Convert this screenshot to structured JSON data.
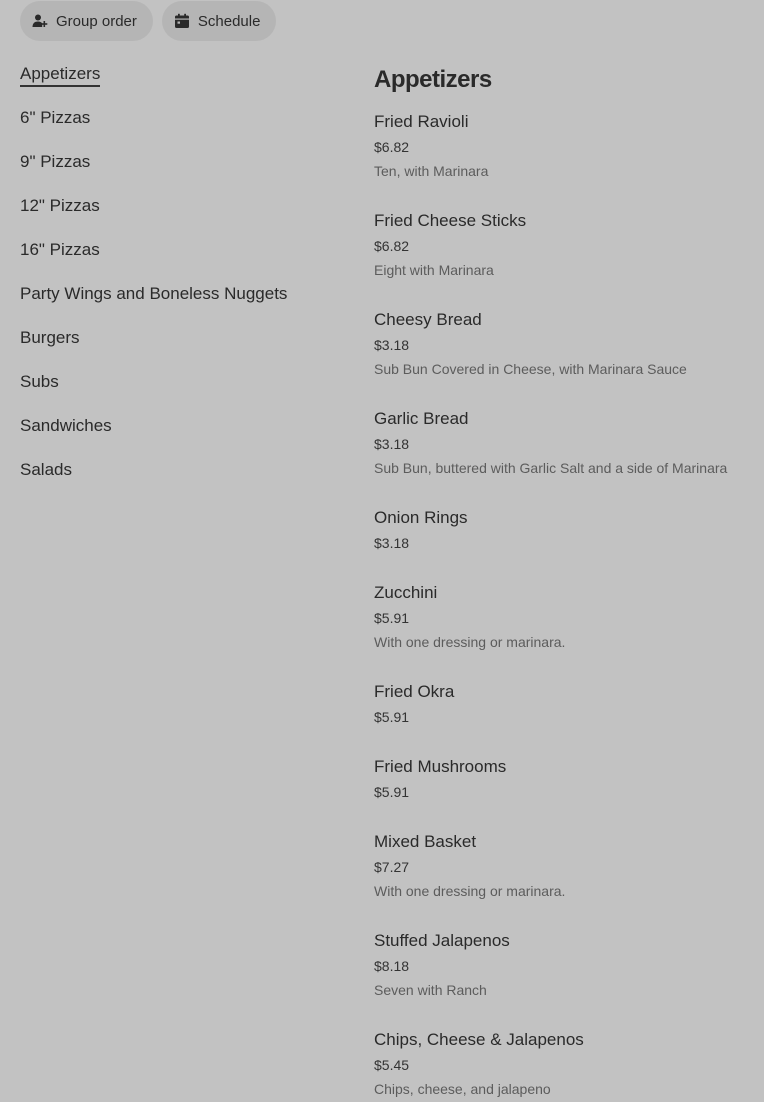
{
  "actions": {
    "group_order": "Group order",
    "schedule": "Schedule"
  },
  "categories": [
    {
      "label": "Appetizers",
      "active": true
    },
    {
      "label": "6\" Pizzas"
    },
    {
      "label": "9\" Pizzas"
    },
    {
      "label": "12\" Pizzas"
    },
    {
      "label": "16\" Pizzas"
    },
    {
      "label": "Party Wings and Boneless Nuggets"
    },
    {
      "label": "Burgers"
    },
    {
      "label": "Subs"
    },
    {
      "label": "Sandwiches"
    },
    {
      "label": "Salads"
    }
  ],
  "section": {
    "title": "Appetizers",
    "items": [
      {
        "name": "Fried Ravioli",
        "price": "$6.82",
        "desc": "Ten, with Marinara"
      },
      {
        "name": "Fried Cheese Sticks",
        "price": "$6.82",
        "desc": "Eight with Marinara"
      },
      {
        "name": "Cheesy Bread",
        "price": "$3.18",
        "desc": "Sub Bun Covered in Cheese, with Marinara Sauce"
      },
      {
        "name": "Garlic Bread",
        "price": "$3.18",
        "desc": "Sub Bun, buttered with Garlic Salt and a side of Marinara"
      },
      {
        "name": "Onion Rings",
        "price": "$3.18",
        "desc": ""
      },
      {
        "name": "Zucchini",
        "price": "$5.91",
        "desc": "With one dressing or marinara."
      },
      {
        "name": "Fried Okra",
        "price": "$5.91",
        "desc": ""
      },
      {
        "name": "Fried Mushrooms",
        "price": "$5.91",
        "desc": ""
      },
      {
        "name": "Mixed Basket",
        "price": "$7.27",
        "desc": "With one dressing or marinara."
      },
      {
        "name": "Stuffed Jalapenos",
        "price": "$8.18",
        "desc": "Seven with Ranch"
      },
      {
        "name": "Chips, Cheese & Jalapenos",
        "price": "$5.45",
        "desc": "Chips, cheese, and jalapeno"
      }
    ]
  },
  "icons": {
    "group_order": "add-person-icon",
    "schedule": "calendar-icon"
  }
}
